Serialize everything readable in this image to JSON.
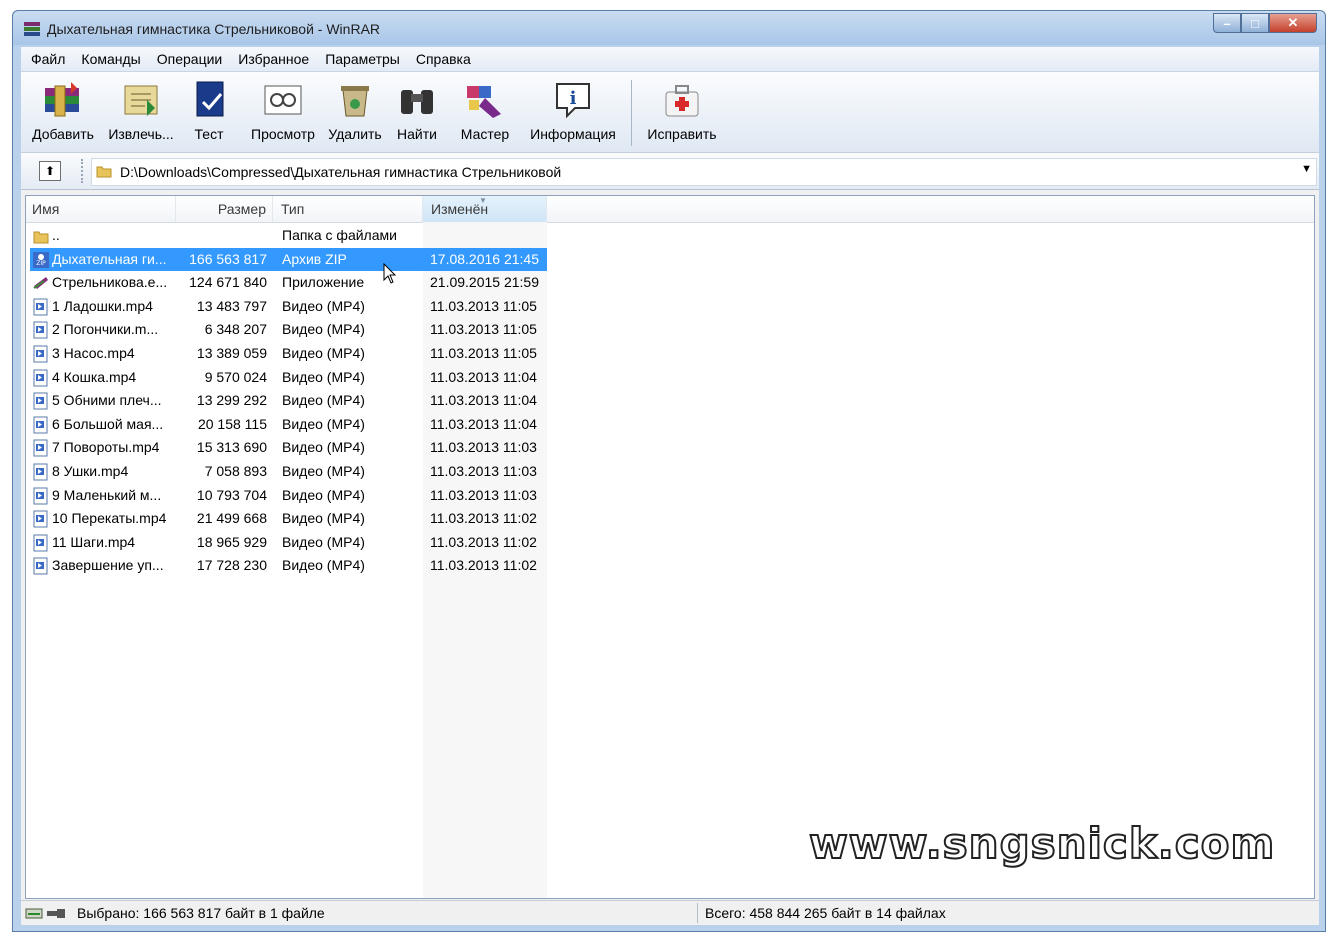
{
  "window": {
    "title": "Дыхательная гимнастика Стрельниковой - WinRAR"
  },
  "menu": [
    "Файл",
    "Команды",
    "Операции",
    "Избранное",
    "Параметры",
    "Справка"
  ],
  "toolbar": [
    {
      "label": "Добавить",
      "icon": "add-archive-icon"
    },
    {
      "label": "Извлечь...",
      "icon": "extract-icon"
    },
    {
      "label": "Тест",
      "icon": "test-icon"
    },
    {
      "label": "Просмотр",
      "icon": "view-icon"
    },
    {
      "label": "Удалить",
      "icon": "delete-icon"
    },
    {
      "label": "Найти",
      "icon": "find-binoculars-icon"
    },
    {
      "label": "Мастер",
      "icon": "wizard-icon"
    },
    {
      "label": "Информация",
      "icon": "info-icon"
    },
    {
      "label": "Исправить",
      "icon": "repair-kit-icon"
    }
  ],
  "address": {
    "path": "D:\\Downloads\\Compressed\\Дыхательная гимнастика Стрельниковой"
  },
  "columns": {
    "name": "Имя",
    "size": "Размер",
    "type": "Тип",
    "modified": "Изменён"
  },
  "files": [
    {
      "name": "..",
      "size": "",
      "type": "Папка с файлами",
      "modified": "",
      "icon": "folder"
    },
    {
      "name": "Дыхательная ги...",
      "size": "166 563 817",
      "type": "Архив ZIP",
      "modified": "17.08.2016 21:45",
      "icon": "zip",
      "selected": true
    },
    {
      "name": "Стрельникова.e...",
      "size": "124 671 840",
      "type": "Приложение",
      "modified": "21.09.2015 21:59",
      "icon": "exe"
    },
    {
      "name": "1 Ладошки.mp4",
      "size": "13 483 797",
      "type": "Видео (MP4)",
      "modified": "11.03.2013 11:05",
      "icon": "video"
    },
    {
      "name": "2 Погончики.m...",
      "size": "6 348 207",
      "type": "Видео (MP4)",
      "modified": "11.03.2013 11:05",
      "icon": "video"
    },
    {
      "name": "3 Насос.mp4",
      "size": "13 389 059",
      "type": "Видео (MP4)",
      "modified": "11.03.2013 11:05",
      "icon": "video"
    },
    {
      "name": "4 Кошка.mp4",
      "size": "9 570 024",
      "type": "Видео (MP4)",
      "modified": "11.03.2013 11:04",
      "icon": "video"
    },
    {
      "name": "5 Обними плеч...",
      "size": "13 299 292",
      "type": "Видео (MP4)",
      "modified": "11.03.2013 11:04",
      "icon": "video"
    },
    {
      "name": "6 Большой мая...",
      "size": "20 158 115",
      "type": "Видео (MP4)",
      "modified": "11.03.2013 11:04",
      "icon": "video"
    },
    {
      "name": "7 Повороты.mp4",
      "size": "15 313 690",
      "type": "Видео (MP4)",
      "modified": "11.03.2013 11:03",
      "icon": "video"
    },
    {
      "name": "8 Ушки.mp4",
      "size": "7 058 893",
      "type": "Видео (MP4)",
      "modified": "11.03.2013 11:03",
      "icon": "video"
    },
    {
      "name": "9 Маленький м...",
      "size": "10 793 704",
      "type": "Видео (MP4)",
      "modified": "11.03.2013 11:03",
      "icon": "video"
    },
    {
      "name": "10 Перекаты.mp4",
      "size": "21 499 668",
      "type": "Видео (MP4)",
      "modified": "11.03.2013 11:02",
      "icon": "video"
    },
    {
      "name": "11 Шаги.mp4",
      "size": "18 965 929",
      "type": "Видео (MP4)",
      "modified": "11.03.2013 11:02",
      "icon": "video"
    },
    {
      "name": "Завершение уп...",
      "size": "17 728 230",
      "type": "Видео (MP4)",
      "modified": "11.03.2013 11:02",
      "icon": "video"
    }
  ],
  "watermark": "www.sngsnick.com",
  "status": {
    "selected": "Выбрано: 166 563 817 байт в 1 файле",
    "total": "Всего: 458 844 265 байт в 14 файлах"
  },
  "colors": {
    "selection": "#3399ff",
    "titlebar": "#b9d1ea"
  }
}
